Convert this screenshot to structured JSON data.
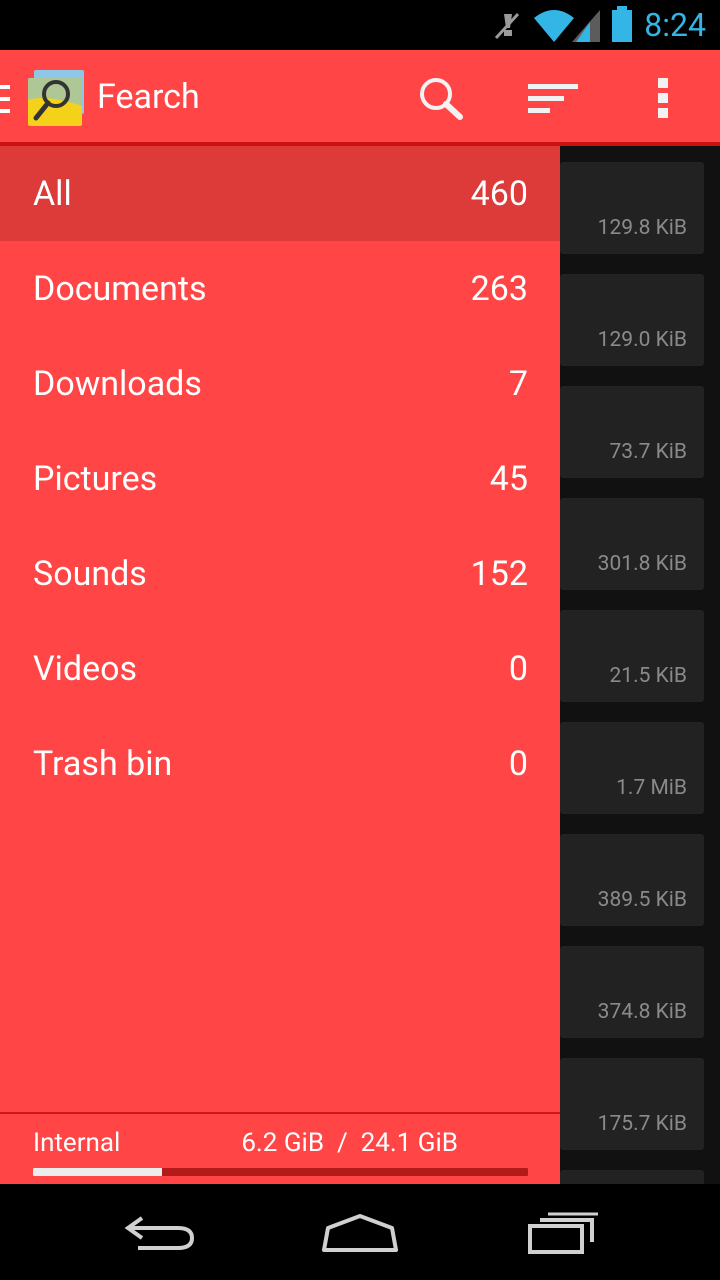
{
  "status_bar": {
    "time": "8:24",
    "icons": [
      "muted-icon",
      "wifi-icon",
      "signal-icon",
      "battery-icon"
    ]
  },
  "action_bar": {
    "title": "Fearch",
    "actions": [
      "search-icon",
      "sort-icon",
      "overflow-menu-icon"
    ]
  },
  "drawer": {
    "items": [
      {
        "label": "All",
        "count": "460",
        "selected": true
      },
      {
        "label": "Documents",
        "count": "263"
      },
      {
        "label": "Downloads",
        "count": "7"
      },
      {
        "label": "Pictures",
        "count": "45"
      },
      {
        "label": "Sounds",
        "count": "152"
      },
      {
        "label": "Videos",
        "count": "0"
      },
      {
        "label": "Trash bin",
        "count": "0"
      }
    ],
    "storage": {
      "label": "Internal",
      "used": "6.2 GiB",
      "separator": "/",
      "total": "24.1 GiB",
      "used_fraction": 0.26
    }
  },
  "background_list": {
    "sizes": [
      "129.8 KiB",
      "129.0 KiB",
      "73.7 KiB",
      "301.8 KiB",
      "21.5 KiB",
      "1.7 MiB",
      "389.5 KiB",
      "374.8 KiB",
      "175.7 KiB"
    ]
  },
  "colors": {
    "accent": "#ff4545",
    "accent_dark": "#dd3a3a",
    "status_blue": "#33b5e5"
  },
  "nav_bar": {
    "buttons": [
      "back-icon",
      "home-icon",
      "recents-icon"
    ]
  }
}
